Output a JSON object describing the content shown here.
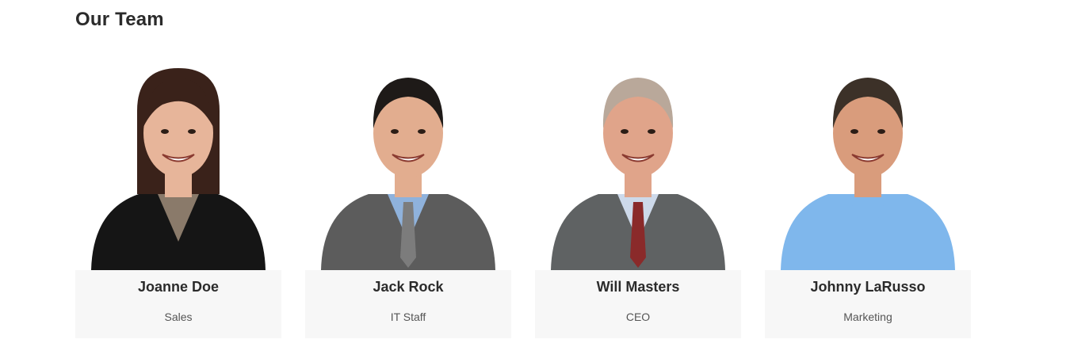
{
  "section": {
    "title": "Our Team"
  },
  "members": [
    {
      "name": "Joanne Doe",
      "role": "Sales",
      "photo": {
        "hair": "#3a221a",
        "skin": "#e7b59a",
        "suit": "#151515",
        "shirt": "#8a7a6a",
        "tie": ""
      }
    },
    {
      "name": "Jack Rock",
      "role": "IT Staff",
      "photo": {
        "hair": "#1e1a18",
        "skin": "#e2ad8f",
        "suit": "#5c5c5c",
        "shirt": "#8fb2dc",
        "tie": "#7c7c7c"
      }
    },
    {
      "name": "Will Masters",
      "role": "CEO",
      "photo": {
        "hair": "#b9a89a",
        "skin": "#e0a48a",
        "suit": "#5f6263",
        "shirt": "#cdd9ea",
        "tie": "#8a2a2a"
      }
    },
    {
      "name": "Johnny LaRusso",
      "role": "Marketing",
      "photo": {
        "hair": "#3c3128",
        "skin": "#d99c7c",
        "suit": "#7fb7ec",
        "shirt": "#7fb7ec",
        "tie": ""
      }
    }
  ]
}
